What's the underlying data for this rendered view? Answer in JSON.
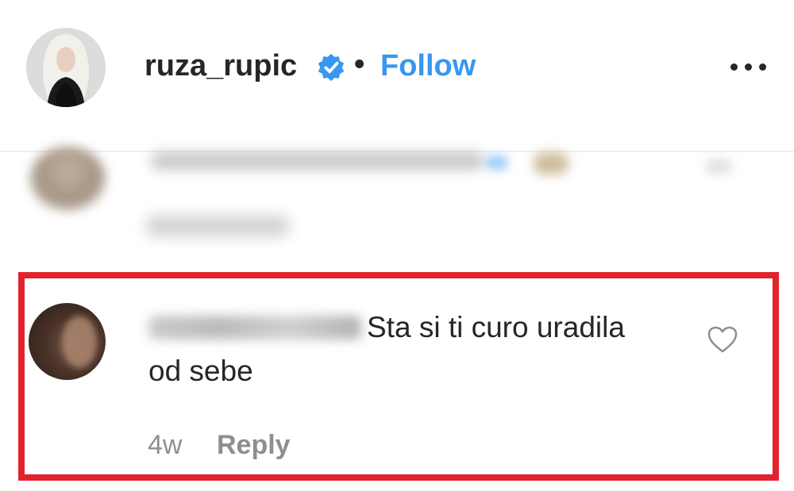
{
  "header": {
    "username": "ruza_rupic",
    "verified_icon": "verified-badge-icon",
    "separator": "•",
    "follow_label": "Follow",
    "more_icon": "more-options-icon"
  },
  "blurred_comment": {
    "redacted": true
  },
  "highlighted_comment": {
    "text_line1": "Sta si ti curo uradila",
    "text_line2": "od sebe",
    "time": "4w",
    "reply_label": "Reply",
    "like_icon": "heart-icon"
  },
  "colors": {
    "accent": "#3897f0",
    "highlight_border": "#e0232d",
    "meta_text": "#8e8e8e"
  }
}
